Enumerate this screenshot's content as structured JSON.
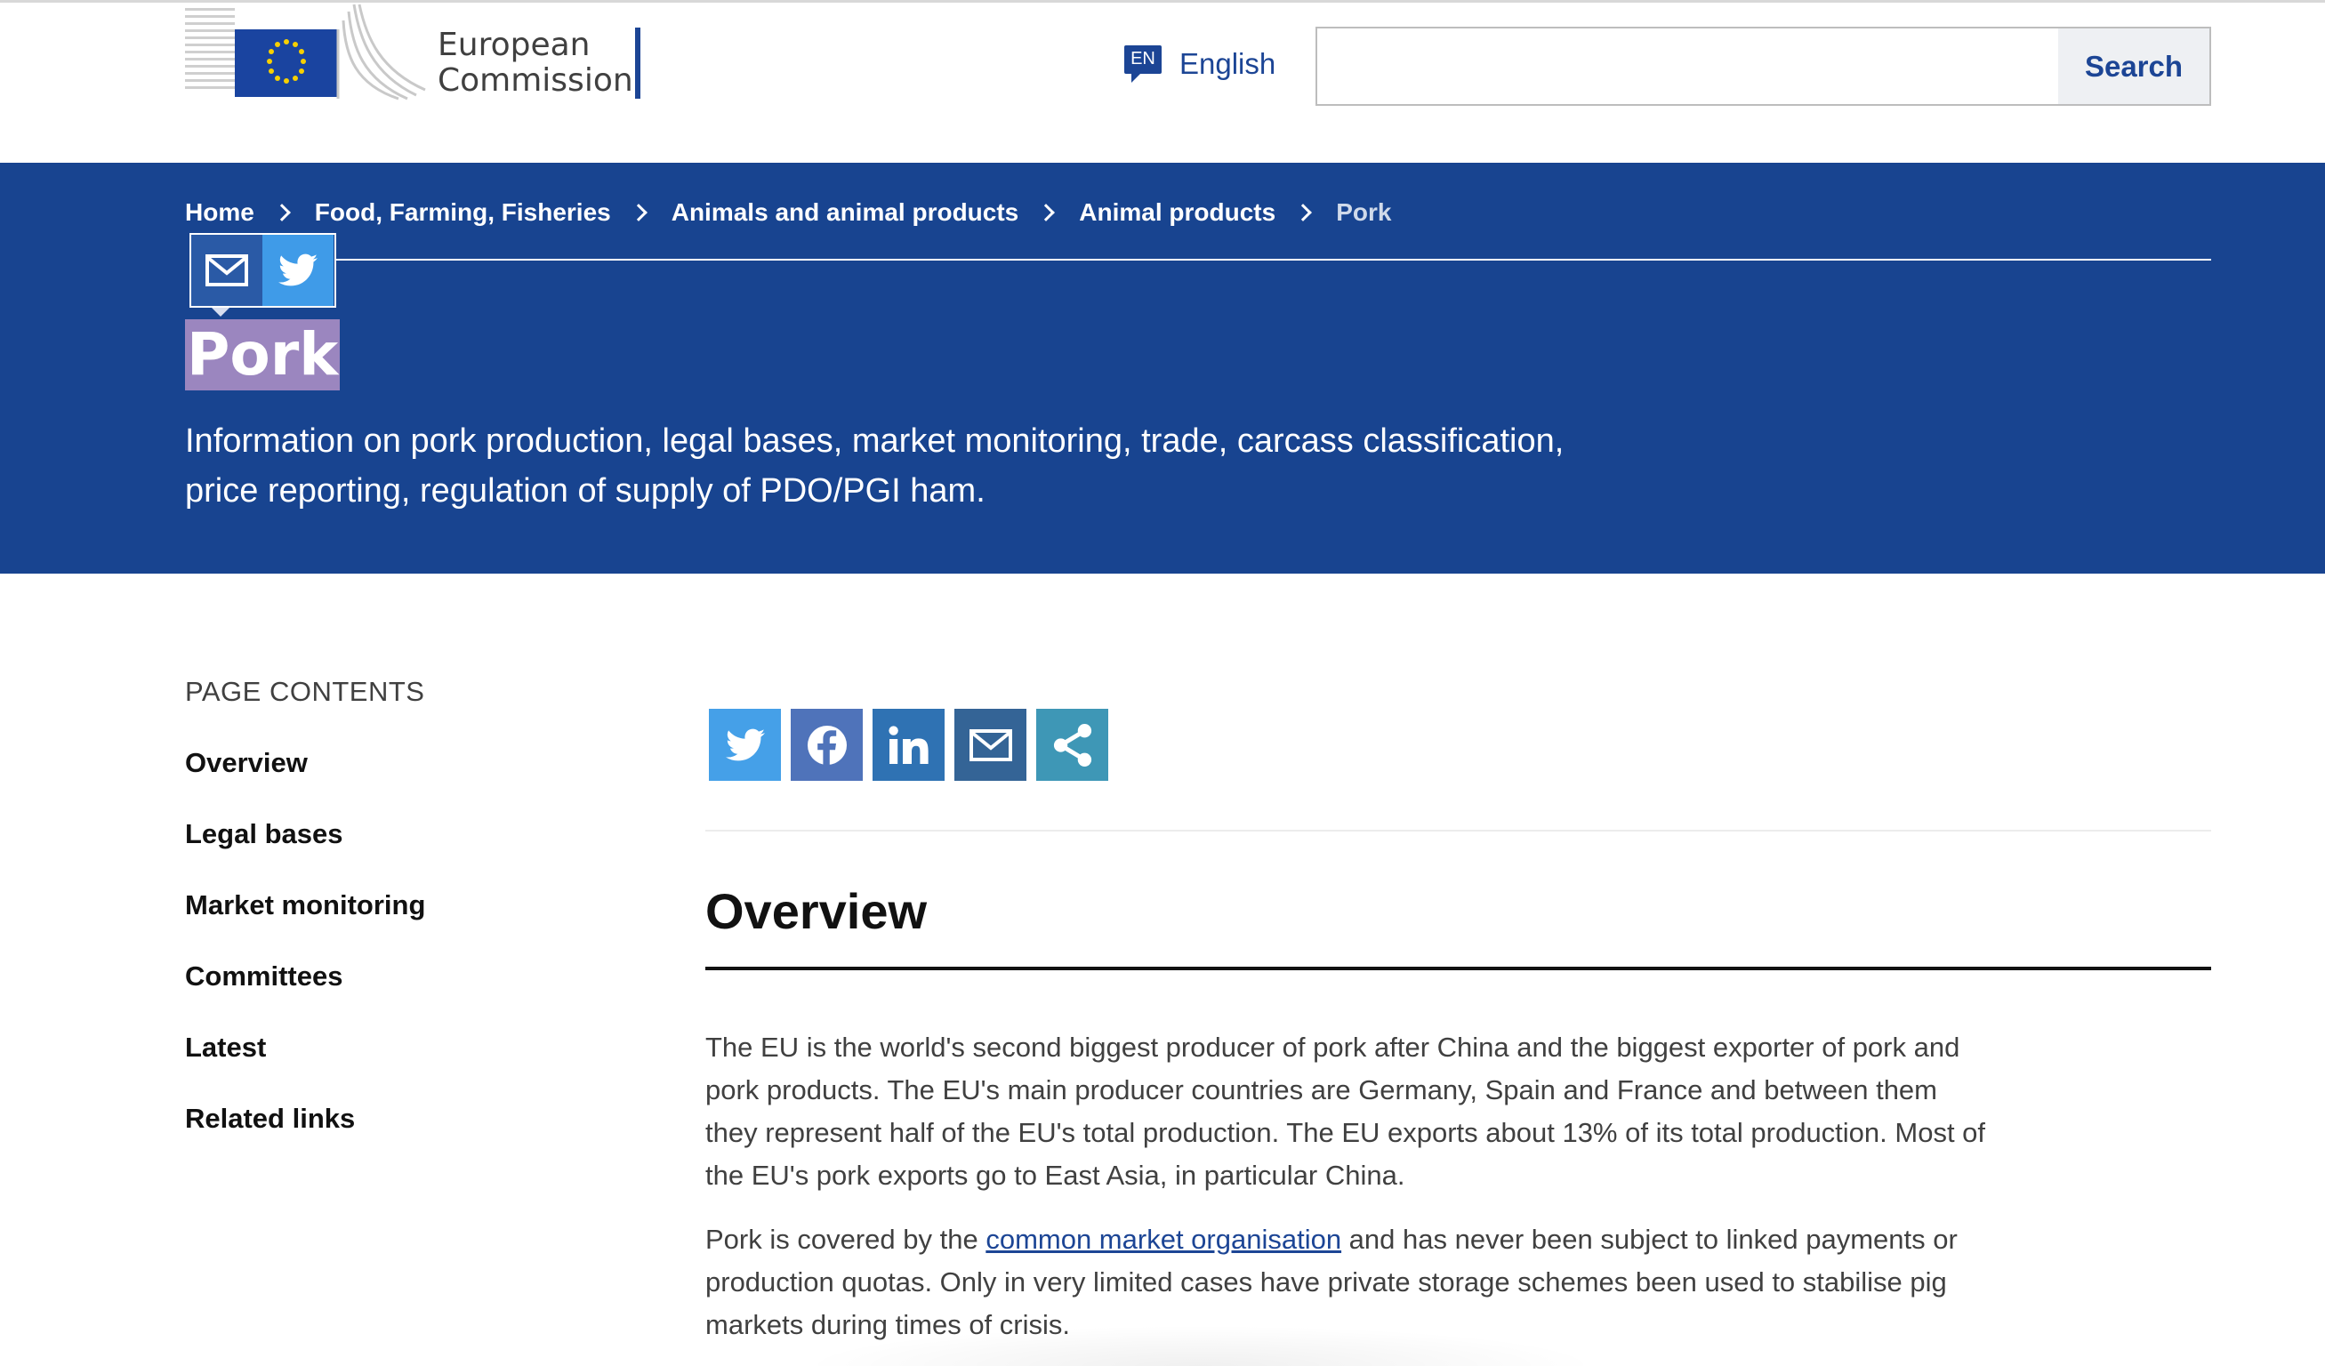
{
  "header": {
    "logo_line1": "European",
    "logo_line2": "Commission",
    "language": {
      "code": "EN",
      "label": "English"
    },
    "search": {
      "placeholder": "",
      "button_label": "Search"
    }
  },
  "breadcrumb": [
    {
      "label": "Home"
    },
    {
      "label": "Food, Farming, Fisheries"
    },
    {
      "label": "Animals and animal products"
    },
    {
      "label": "Animal products"
    },
    {
      "label": "Pork",
      "current": true
    }
  ],
  "banner": {
    "title": "Pork",
    "intro_line1": "Information on pork production, legal bases, market monitoring, trade, carcass classification,",
    "intro_line2": "price reporting, regulation of supply of PDO/PGI ham."
  },
  "share_popup": {
    "icons": [
      "mail-icon",
      "twitter-icon"
    ]
  },
  "toc": {
    "title": "PAGE CONTENTS",
    "items": [
      "Overview",
      "Legal bases",
      "Market monitoring",
      "Committees",
      "Latest",
      "Related links"
    ]
  },
  "share_buttons": [
    "twitter-icon",
    "facebook-icon",
    "linkedin-icon",
    "email-icon",
    "share-icon"
  ],
  "content": {
    "heading": "Overview",
    "para1": "The EU is the world's second biggest producer of pork after China and the biggest exporter of pork and pork products. The EU's main producer countries are Germany, Spain and France and between them they represent half of the EU's total production. The EU exports about 13% of its total production. Most of the EU's pork exports go to East Asia, in particular China.",
    "para2_before": "Pork is covered by the ",
    "para2_link": "common market organisation",
    "para2_after": " and has never been subject to linked payments or production quotas. Only in very limited cases have private storage schemes been used to stabilise pig markets during times of crisis."
  },
  "colors": {
    "brand_blue": "#184490",
    "title_highlight": "#9b86bf",
    "link": "#1c4595"
  }
}
